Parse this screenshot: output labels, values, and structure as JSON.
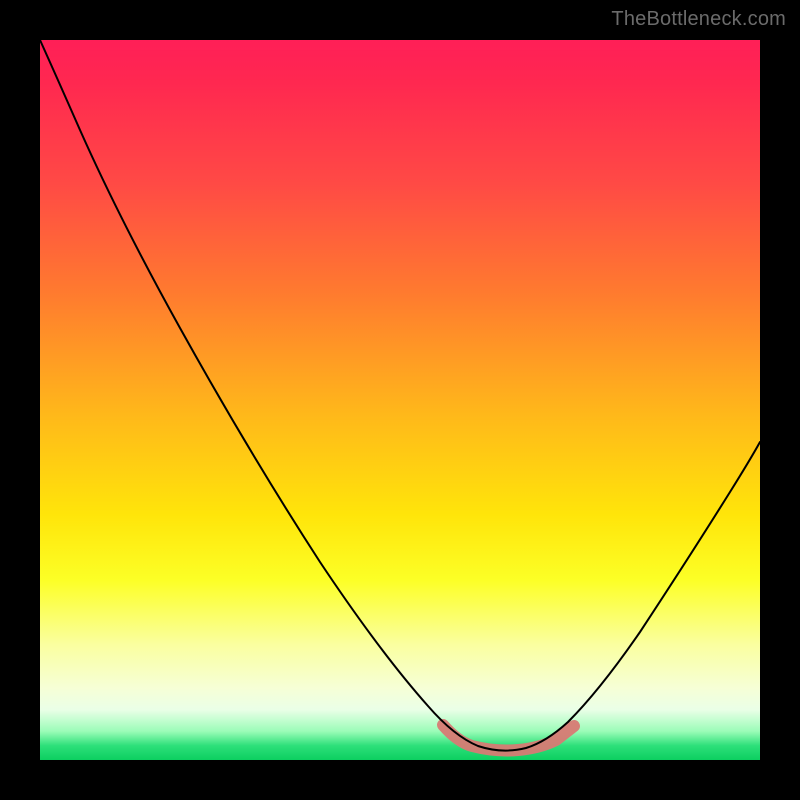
{
  "watermark": {
    "text": "TheBottleneck.com"
  },
  "chart_data": {
    "type": "line",
    "title": "",
    "xlabel": "",
    "ylabel": "",
    "xlim": [
      0,
      100
    ],
    "ylim": [
      0,
      100
    ],
    "grid": false,
    "series": [
      {
        "name": "curve",
        "x": [
          0,
          4,
          8,
          12,
          18,
          25,
          32,
          40,
          48,
          54,
          58,
          61,
          63,
          65,
          68,
          72,
          75,
          80,
          86,
          92,
          100
        ],
        "y": [
          100,
          96,
          91,
          85,
          76,
          65,
          54,
          41,
          28,
          18,
          11,
          6,
          4,
          3,
          3,
          4,
          6,
          12,
          22,
          33,
          48
        ]
      }
    ],
    "highlight_range_x": [
      56,
      74
    ],
    "background_gradient": {
      "top": "#ff1f57",
      "mid": "#ffe50a",
      "bottom": "#0ccf60"
    }
  }
}
